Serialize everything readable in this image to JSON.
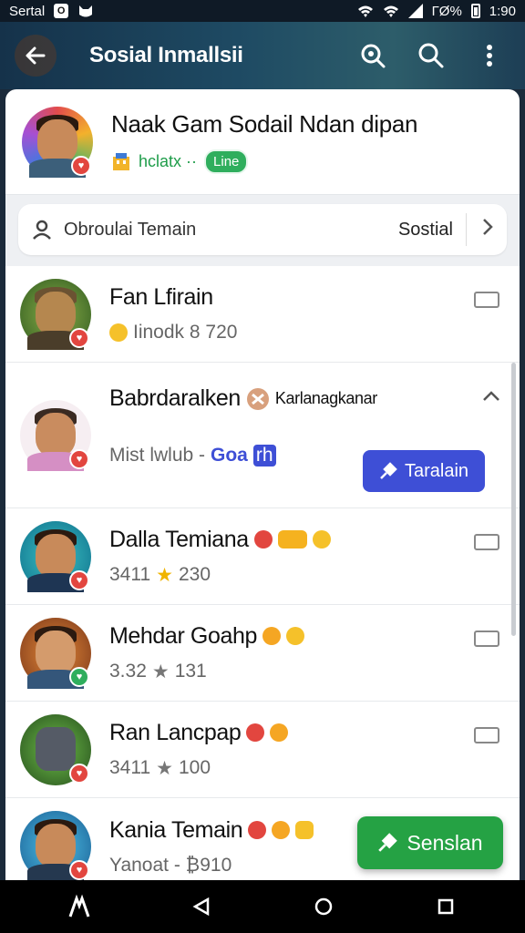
{
  "status_bar": {
    "carrier": "Sertal",
    "app_badge": "O",
    "battery_text": "ГØ%",
    "time": "1:90"
  },
  "app_bar": {
    "title": "Sosial Inmallsii"
  },
  "profile": {
    "name": "Naak Gam Sodail Ndan dipan",
    "subtitle": "hclatx ··",
    "chip": "Line"
  },
  "search": {
    "placeholder": "Obroulai Temain",
    "tag": "Sostial"
  },
  "friends": [
    {
      "name": "Fan Lfirain",
      "meta": "Iinodk 8 720"
    },
    {
      "name": "Babrdaralken",
      "tag": "Karlanagkanar",
      "meta": "Mist lwlub - ",
      "meta_link": "Goa",
      "meta_tag": "rh",
      "button": "Taralain"
    },
    {
      "name": "Dalla Temiana",
      "meta": "3411",
      "star": "★",
      "score": "230"
    },
    {
      "name": "Mehdar Goahp",
      "meta": "3.32",
      "star": "★",
      "score": "131"
    },
    {
      "name": "Ran Lancpap",
      "meta": "3411",
      "star": "★",
      "score": "100"
    },
    {
      "name": "Kania Temain",
      "meta": "Yanoat - ₿910"
    }
  ],
  "fab": {
    "label": "Senslan"
  },
  "colors": {
    "accent_blue": "#3e4fd6",
    "accent_green": "#25a244",
    "star_gold": "#f0b400"
  }
}
